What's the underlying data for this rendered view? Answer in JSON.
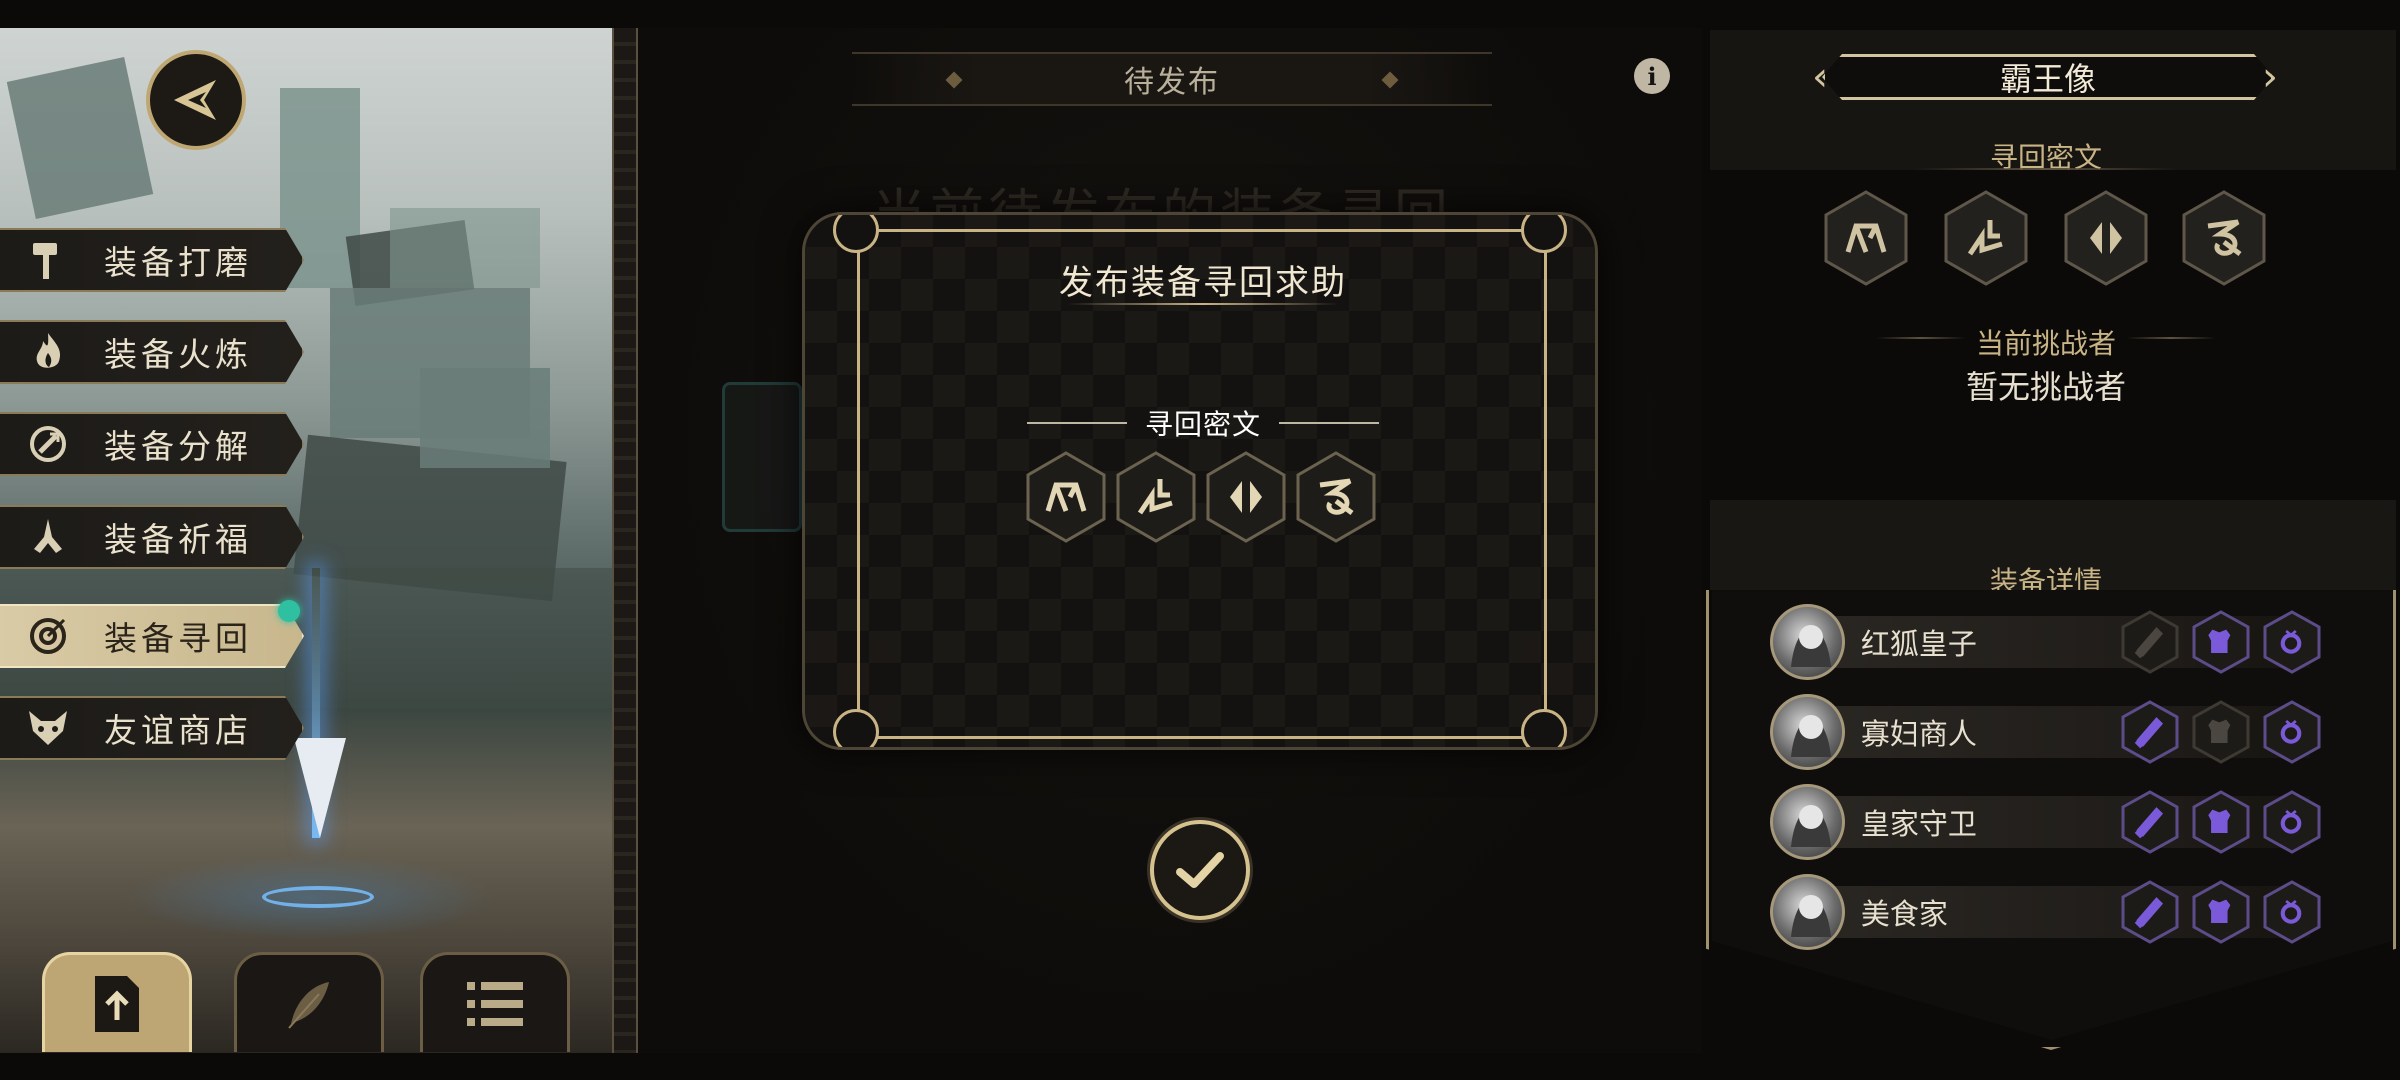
{
  "left_menu": {
    "items": [
      {
        "label": "装备打磨",
        "icon": "hammer-icon",
        "active": false
      },
      {
        "label": "装备火炼",
        "icon": "flame-icon",
        "active": false
      },
      {
        "label": "装备分解",
        "icon": "disassemble-icon",
        "active": false
      },
      {
        "label": "装备祈福",
        "icon": "pray-hands-icon",
        "active": false
      },
      {
        "label": "装备寻回",
        "icon": "target-icon",
        "active": true
      },
      {
        "label": "友谊商店",
        "icon": "fox-icon",
        "active": false
      }
    ]
  },
  "bottom_tabs": [
    {
      "icon": "upload-document-icon",
      "active": true
    },
    {
      "icon": "feather-icon",
      "active": false
    },
    {
      "icon": "list-icon",
      "active": false
    }
  ],
  "center": {
    "status_banner": "待发布",
    "background_heading": "当前待发布的装备寻回"
  },
  "modal": {
    "title": "发布装备寻回求助",
    "subtitle": "寻回密文",
    "glyphs": [
      "rune-1-icon",
      "rune-2-icon",
      "rune-3-icon",
      "rune-4-icon"
    ]
  },
  "right_panel": {
    "boss_name": "霸王像",
    "cipher_title": "寻回密文",
    "challenger_label": "当前挑战者",
    "challenger_value": "暂无挑战者",
    "detail_title": "装备详情",
    "heroes": [
      {
        "name": "红狐皇子",
        "slots": [
          "empty",
          "filled",
          "filled"
        ]
      },
      {
        "name": "寡妇商人",
        "slots": [
          "filled",
          "empty",
          "filled"
        ]
      },
      {
        "name": "皇家守卫",
        "slots": [
          "filled",
          "filled",
          "filled"
        ]
      },
      {
        "name": "美食家",
        "slots": [
          "filled",
          "filled",
          "filled"
        ]
      }
    ]
  },
  "colors": {
    "gold": "#c9b486",
    "slot_filled": "#7a5ad8",
    "slot_empty": "#4b4740",
    "notify": "#2fc0a2"
  }
}
